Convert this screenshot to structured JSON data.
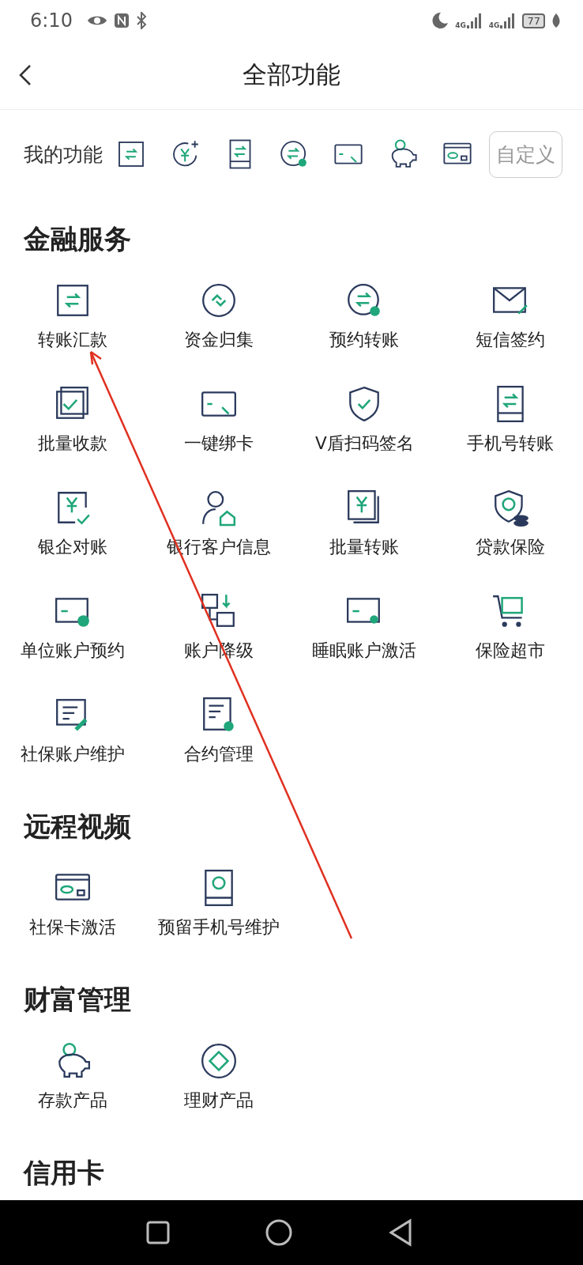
{
  "status_bar": {
    "time": "6:10",
    "networks": [
      "4G",
      "4G"
    ],
    "battery": "77"
  },
  "header": {
    "title": "全部功能"
  },
  "my_functions": {
    "label": "我的功能",
    "button": "自定义"
  },
  "sections": [
    {
      "title": "金融服务",
      "items": [
        "转账汇款",
        "资金归集",
        "预约转账",
        "短信签约",
        "批量收款",
        "一键绑卡",
        "V盾扫码签名",
        "手机号转账",
        "银企对账",
        "银行客户信息",
        "批量转账",
        "贷款保险",
        "单位账户预约",
        "账户降级",
        "睡眠账户激活",
        "保险超市",
        "社保账户维护",
        "合约管理"
      ]
    },
    {
      "title": "远程视频",
      "items": [
        "社保卡激活",
        "预留手机号维护"
      ]
    },
    {
      "title": "财富管理",
      "items": [
        "存款产品",
        "理财产品"
      ]
    },
    {
      "title": "信用卡"
    }
  ]
}
